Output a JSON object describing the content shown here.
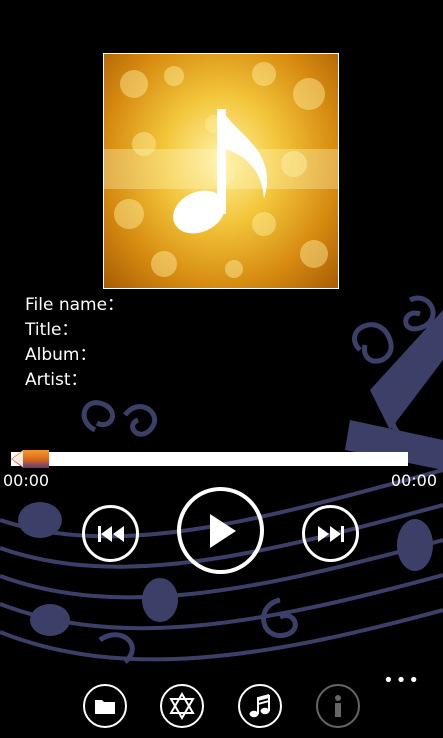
{
  "now_playing": {
    "file_name_label": "File name：",
    "title_label": "Title：",
    "album_label": "Album：",
    "artist_label": "Artist："
  },
  "progress": {
    "elapsed": "00:00",
    "duration": "00:00",
    "position_fraction": 0.0
  },
  "controls": {
    "previous_icon": "skip-previous-icon",
    "play_icon": "play-icon",
    "next_icon": "skip-next-icon"
  },
  "app_bar": {
    "buttons": [
      {
        "icon": "folder-icon",
        "enabled": true
      },
      {
        "icon": "star-of-david-icon",
        "enabled": true
      },
      {
        "icon": "music-notes-icon",
        "enabled": true
      },
      {
        "icon": "info-icon",
        "enabled": false
      }
    ],
    "more_label": "•••"
  },
  "colors": {
    "background": "#000000",
    "swirl": "#3c4068",
    "album_gold": "#f0b52a",
    "thumb_orange": "#e07a1a",
    "fill_purple": "#4a3a7a"
  }
}
